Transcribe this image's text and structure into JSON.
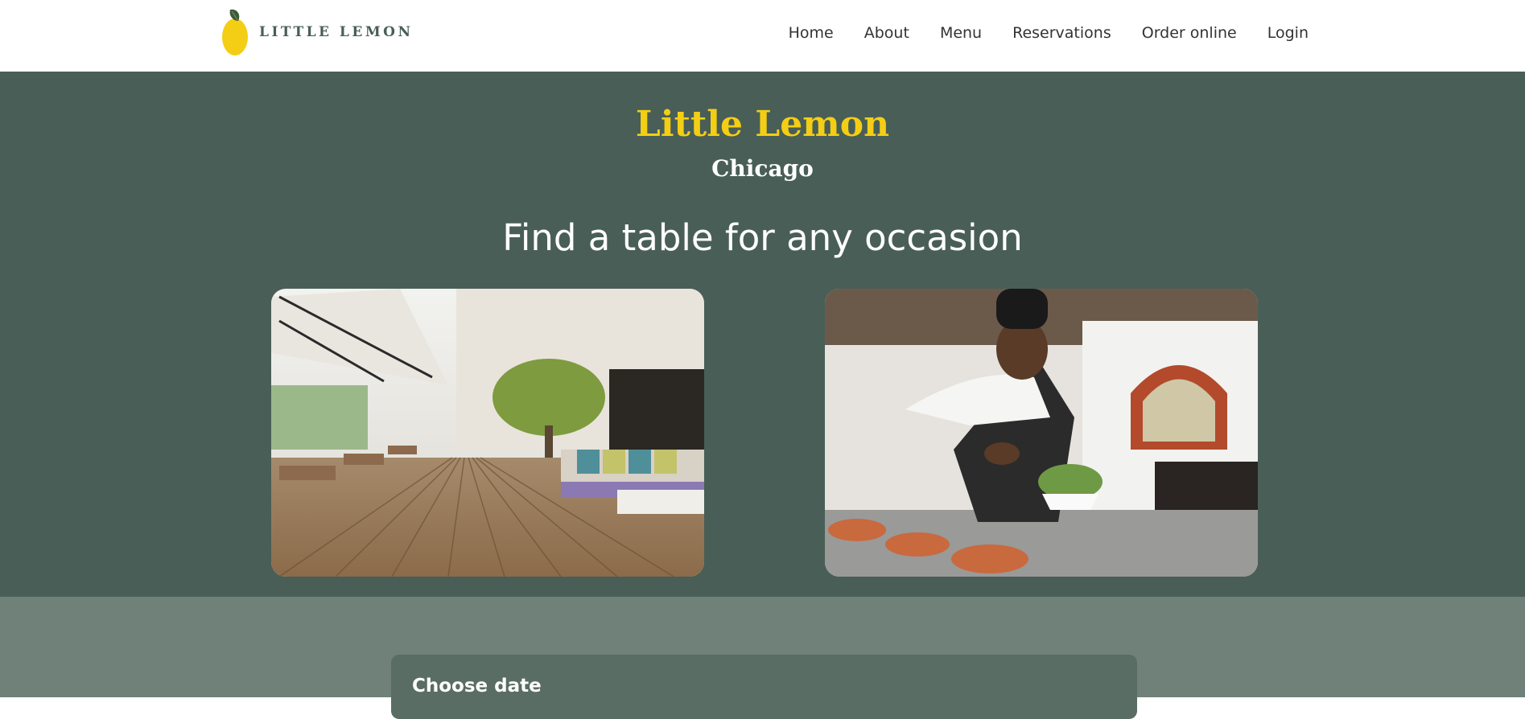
{
  "brand": {
    "name": "LITTLE LEMON"
  },
  "nav": {
    "items": [
      {
        "label": "Home"
      },
      {
        "label": "About"
      },
      {
        "label": "Menu"
      },
      {
        "label": "Reservations"
      },
      {
        "label": "Order online"
      },
      {
        "label": "Login"
      }
    ]
  },
  "hero": {
    "title": "Little Lemon",
    "subtitle": "Chicago",
    "tagline": "Find a table for any occasion",
    "images": [
      {
        "subject": "restaurant-terrace"
      },
      {
        "subject": "chef-plating"
      }
    ]
  },
  "reservation_form": {
    "date_label": "Choose date"
  },
  "colors": {
    "primary_green": "#495e57",
    "primary_yellow": "#f4ce14",
    "form_background": "#6f8179",
    "nav_text": "#333333"
  }
}
